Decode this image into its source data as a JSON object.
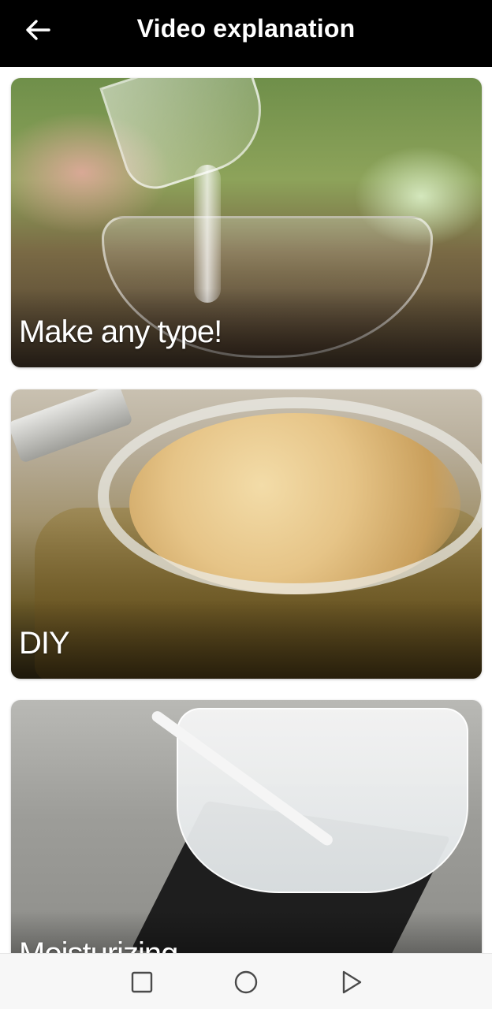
{
  "header": {
    "title": "Video explanation",
    "back_icon": "arrow-left-icon"
  },
  "videos": [
    {
      "label": "Make any type!",
      "thumbnail": "glass-bowl-pouring-liquid"
    },
    {
      "label": "DIY",
      "thumbnail": "jar-of-sugar-scrub"
    },
    {
      "label": "Moisturizing",
      "thumbnail": "measuring-cup-on-scale"
    }
  ],
  "navbar": {
    "recents_icon": "square-recents-icon",
    "home_icon": "circle-home-icon",
    "back_icon": "triangle-back-icon"
  },
  "colors": {
    "appbar_bg": "#000000",
    "appbar_text": "#ffffff",
    "navbar_bg": "#f7f7f7",
    "nav_icon": "#4a4a4a",
    "card_label": "#ffffff"
  }
}
